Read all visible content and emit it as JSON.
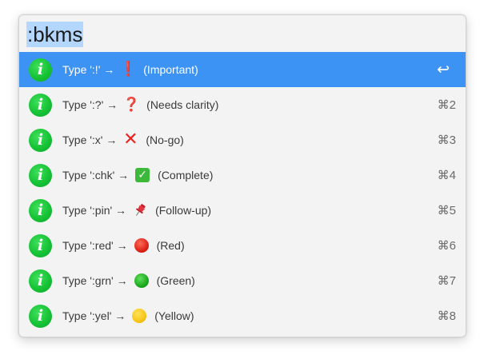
{
  "query": ":bkms",
  "results": [
    {
      "prefix": "Type ':!' →",
      "glyph": "❗",
      "glyph_icon": "exclamation-icon",
      "label": "(Important)",
      "shortcut": "↩",
      "selected": true
    },
    {
      "prefix": "Type ':?' →",
      "glyph": "❓",
      "glyph_icon": "question-icon",
      "label": "(Needs clarity)",
      "shortcut": "⌘2",
      "selected": false
    },
    {
      "prefix": "Type ':x' →",
      "glyph": "✕",
      "glyph_icon": "cross-icon",
      "label": "(No-go)",
      "shortcut": "⌘3",
      "selected": false
    },
    {
      "prefix": "Type ':chk' →",
      "glyph": "✓",
      "glyph_icon": "check-box-icon",
      "label": "(Complete)",
      "shortcut": "⌘4",
      "selected": false
    },
    {
      "prefix": "Type ':pin' →",
      "glyph": "📌",
      "glyph_icon": "pin-icon",
      "label": "(Follow-up)",
      "shortcut": "⌘5",
      "selected": false
    },
    {
      "prefix": "Type ':red' →",
      "glyph": "",
      "glyph_icon": "red-circle-icon",
      "label": "(Red)",
      "shortcut": "⌘6",
      "selected": false
    },
    {
      "prefix": "Type ':grn' →",
      "glyph": "",
      "glyph_icon": "green-circle-icon",
      "label": "(Green)",
      "shortcut": "⌘7",
      "selected": false
    },
    {
      "prefix": "Type ':yel' →",
      "glyph": "",
      "glyph_icon": "yellow-circle-icon",
      "label": "(Yellow)",
      "shortcut": "⌘8",
      "selected": false
    }
  ],
  "info_icon_letter": "i",
  "colors": {
    "selected_row": "#3d93f4",
    "info_icon": "#14c033",
    "query_highlight": "#b3d7ff"
  }
}
